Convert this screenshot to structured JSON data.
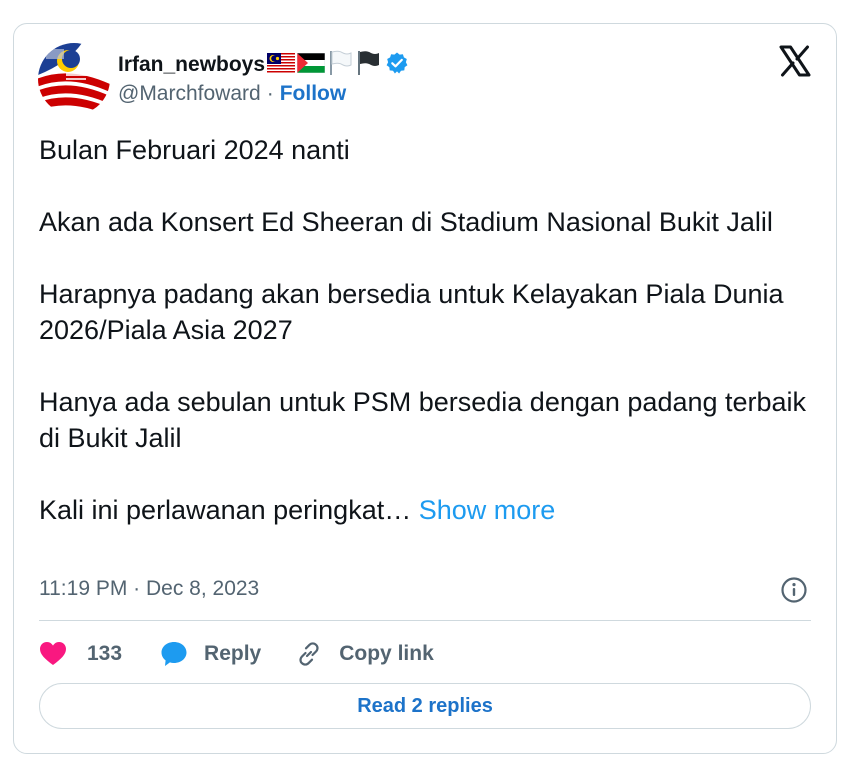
{
  "author": {
    "name": "Irfan_newboys",
    "handle": "@Marchfoward",
    "follow_label": "Follow",
    "separator": "·",
    "verified": true,
    "name_emojis": [
      "malaysia-flag",
      "palestine-flag",
      "white-flag",
      "black-flag"
    ]
  },
  "tweet": {
    "paragraphs": [
      "Bulan Februari 2024 nanti",
      "Akan ada Konsert Ed Sheeran di Stadium Nasional Bukit Jalil",
      "Harapnya padang akan bersedia untuk Kelayakan Piala Dunia 2026/Piala Asia 2027",
      "Hanya ada sebulan untuk PSM bersedia dengan padang terbaik di Bukit Jalil"
    ],
    "truncated_text": "Kali ini perlawanan peringkat…",
    "show_more_label": "Show more",
    "timestamp": "11:19 PM · Dec 8, 2023"
  },
  "actions": {
    "like_count": "133",
    "reply_label": "Reply",
    "copy_link_label": "Copy link"
  },
  "footer": {
    "read_replies_label": "Read 2 replies"
  },
  "colors": {
    "link_blue": "#1d9bf0",
    "follow_blue": "#1d73c9",
    "heart_pink": "#f91880",
    "verified_blue": "#1d9bf0",
    "muted_text": "#536471",
    "border": "#cfd9de"
  }
}
